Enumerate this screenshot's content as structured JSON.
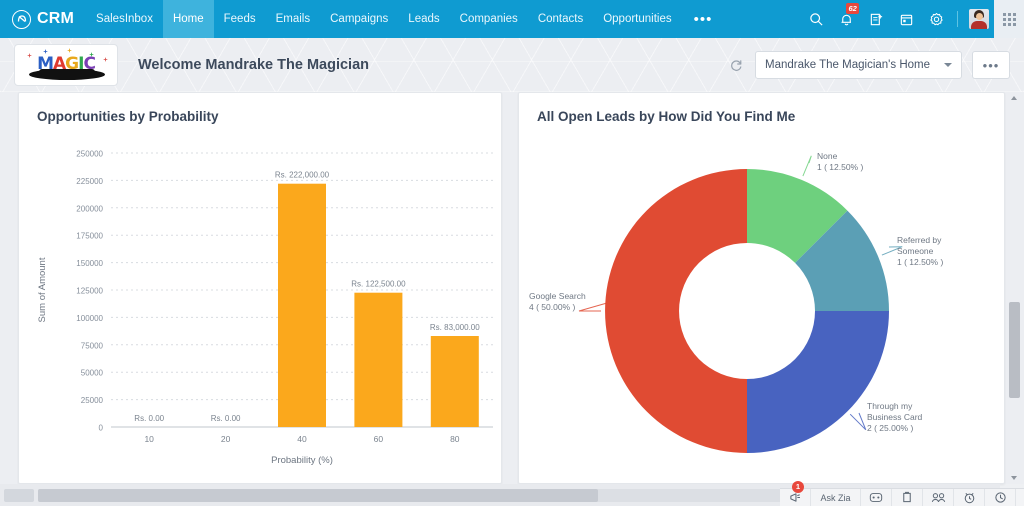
{
  "topnav": {
    "brand": "CRM",
    "brand_icon": "zoho-crm-logo-icon",
    "items": [
      {
        "label": "SalesInbox",
        "active": false
      },
      {
        "label": "Home",
        "active": true
      },
      {
        "label": "Feeds",
        "active": false
      },
      {
        "label": "Emails",
        "active": false
      },
      {
        "label": "Campaigns",
        "active": false
      },
      {
        "label": "Leads",
        "active": false
      },
      {
        "label": "Companies",
        "active": false
      },
      {
        "label": "Contacts",
        "active": false
      },
      {
        "label": "Opportunities",
        "active": false
      }
    ],
    "more_label": "•••",
    "icons": [
      {
        "name": "search-icon"
      },
      {
        "name": "notifications-bell-icon",
        "badge": "62"
      },
      {
        "name": "add-note-icon"
      },
      {
        "name": "calendar-icon"
      },
      {
        "name": "settings-gear-icon"
      }
    ],
    "avatar_name": "user-avatar",
    "apps_name": "apps-grid-icon"
  },
  "welcome": {
    "logo_letters": [
      "M",
      "A",
      "G",
      "I",
      "C"
    ],
    "title": "Welcome Mandrake The Magician",
    "refresh_label": "↻",
    "home_select_value": "Mandrake The Magician's Home",
    "more_label": "•••"
  },
  "charts": {
    "bar_title": "Opportunities by Probability",
    "donut_title": "All Open Leads by How Did You Find Me"
  },
  "chart_data": [
    {
      "type": "bar",
      "title": "Opportunities by Probability",
      "xlabel": "Probability (%)",
      "ylabel": "Sum of Amount",
      "categories": [
        "10",
        "20",
        "40",
        "60",
        "80"
      ],
      "values": [
        0,
        0,
        222000,
        122500,
        83000
      ],
      "data_labels": [
        "Rs. 0.00",
        "Rs. 0.00",
        "Rs. 222,000.00",
        "Rs. 122,500.00",
        "Rs. 83,000.00"
      ],
      "ylim": [
        0,
        250000
      ],
      "yticks": [
        0,
        25000,
        50000,
        75000,
        100000,
        125000,
        150000,
        175000,
        200000,
        225000,
        250000
      ],
      "ytick_labels": [
        "0",
        "25000",
        "50000",
        "75000",
        "100000",
        "125000",
        "150000",
        "175000",
        "200000",
        "225000",
        "250000"
      ],
      "bar_color": "#FBA81C",
      "grid": true,
      "legend": "none"
    },
    {
      "type": "pie",
      "title": "All Open Leads by How Did You Find Me",
      "donut": true,
      "slices": [
        {
          "label": "None",
          "value": 1,
          "percent": "12.50%",
          "display": "1 ( 12.50% )",
          "color": "#6ED07E"
        },
        {
          "label": "Referred by Someone",
          "value": 1,
          "percent": "12.50%",
          "display": "1 ( 12.50% )",
          "color": "#5B9FB5"
        },
        {
          "label": "Through my Business Card",
          "value": 2,
          "percent": "25.00%",
          "display": "2 ( 25.00% )",
          "color": "#4863C0"
        },
        {
          "label": "Google Search",
          "value": 4,
          "percent": "50.00%",
          "display": "4 ( 50.00% )",
          "color": "#E04B33"
        }
      ],
      "total": 8,
      "legend": "labels-outside"
    }
  ],
  "bottombar": {
    "items": [
      {
        "name": "announcement-megaphone-icon",
        "label": "",
        "badge": "1"
      },
      {
        "name": "ask-zia-button",
        "label": "Ask Zia"
      },
      {
        "name": "chat-smiley-icon",
        "label": ""
      },
      {
        "name": "notes-clipboard-icon",
        "label": ""
      },
      {
        "name": "contacts-people-icon",
        "label": ""
      },
      {
        "name": "alarm-clock-icon",
        "label": ""
      },
      {
        "name": "recent-history-icon",
        "label": ""
      },
      {
        "name": "trash-bin-icon",
        "label": ""
      }
    ]
  },
  "scrollbars": {
    "horizontal_name": "horizontal-scrollbar",
    "vertical_name": "vertical-scrollbar"
  }
}
